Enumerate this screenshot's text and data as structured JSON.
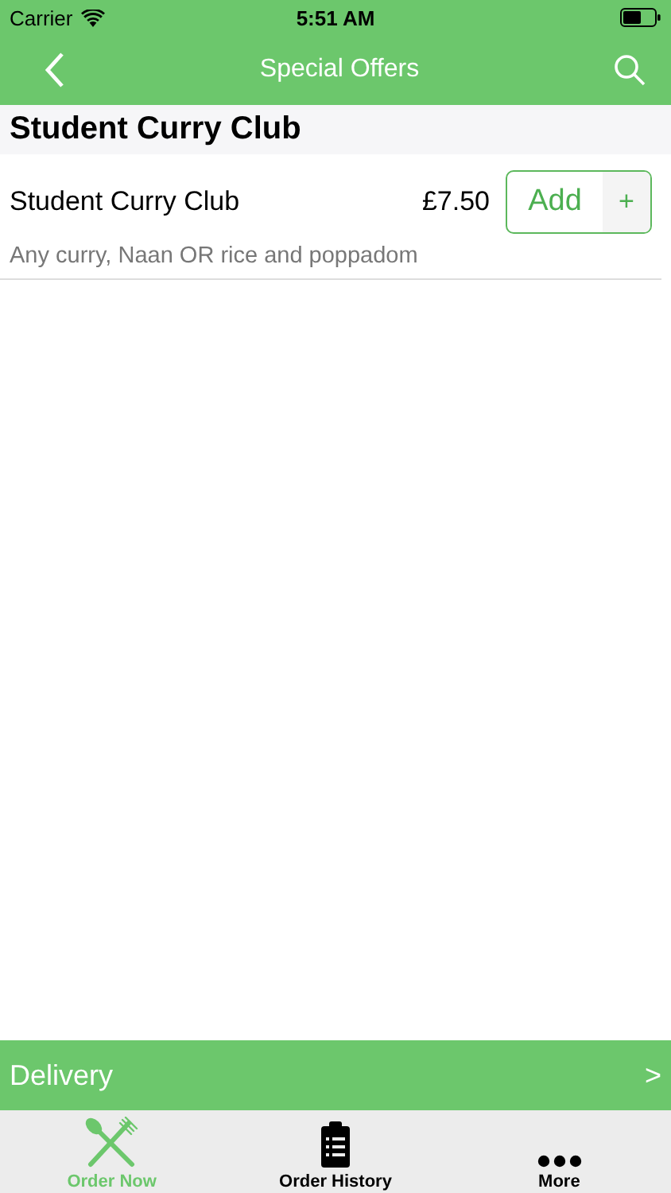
{
  "status_bar": {
    "carrier": "Carrier",
    "time": "5:51 AM"
  },
  "nav_bar": {
    "title": "Special Offers"
  },
  "section": {
    "title": "Student Curry Club"
  },
  "items": [
    {
      "name": "Student Curry Club",
      "price": "£7.50",
      "description": "Any curry, Naan OR rice and poppadom",
      "add_label": "Add",
      "plus": "+"
    }
  ],
  "delivery_bar": {
    "label": "Delivery",
    "chevron": ">"
  },
  "tabs": [
    {
      "label": "Order Now",
      "kind": "cutlery",
      "selected": true
    },
    {
      "label": "Order History",
      "kind": "clipboard",
      "selected": false
    },
    {
      "label": "More",
      "kind": "more",
      "selected": false
    }
  ]
}
